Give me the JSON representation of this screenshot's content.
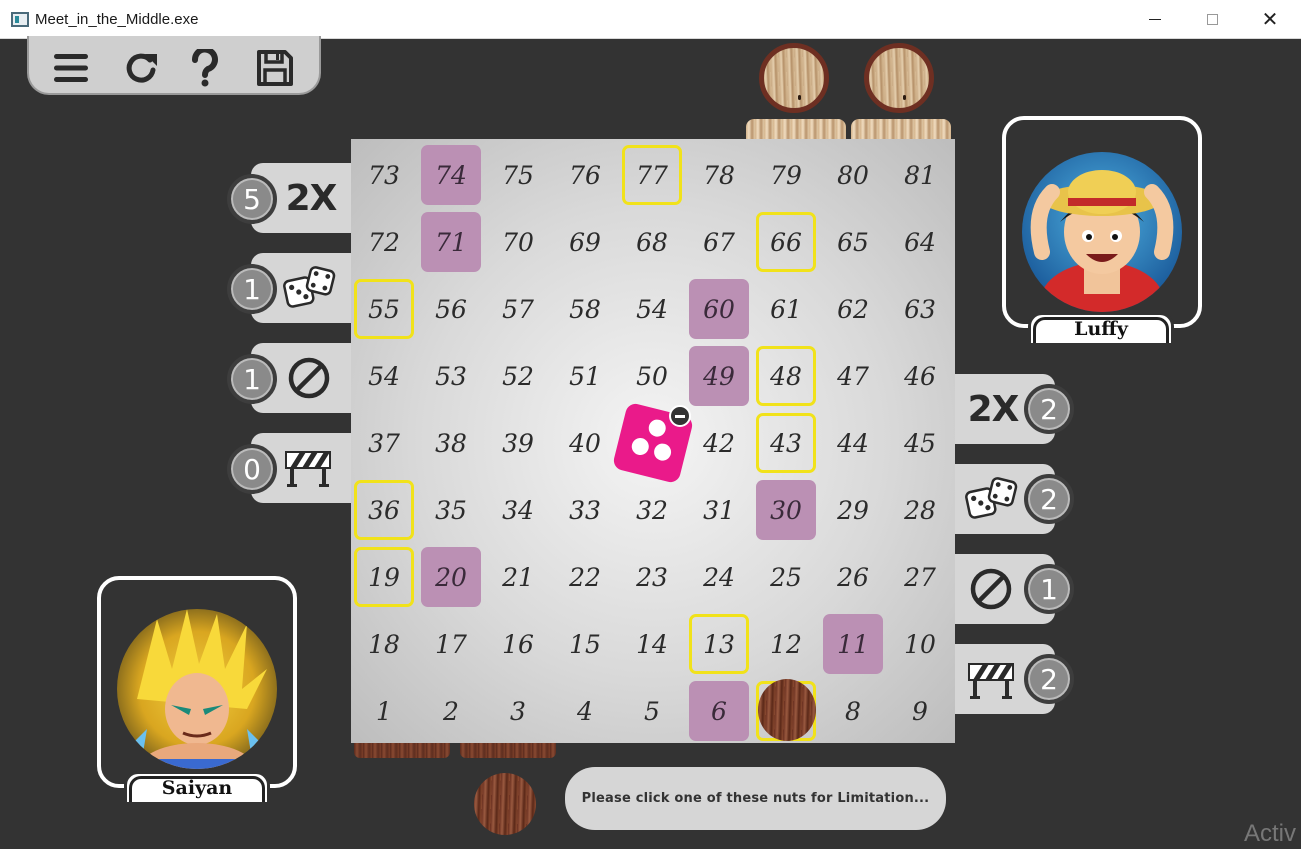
{
  "window": {
    "title": "Meet_in_the_Middle.exe"
  },
  "toolbar": {
    "icons": [
      "menu-icon",
      "restart-icon",
      "help-icon",
      "save-icon"
    ]
  },
  "board": {
    "rows": [
      [
        "73",
        "74",
        "75",
        "76",
        "77",
        "78",
        "79",
        "80",
        "81"
      ],
      [
        "72",
        "71",
        "70",
        "69",
        "68",
        "67",
        "66",
        "65",
        "64"
      ],
      [
        "55",
        "56",
        "57",
        "58",
        "54",
        "60",
        "61",
        "62",
        "63"
      ],
      [
        "54",
        "53",
        "52",
        "51",
        "50",
        "49",
        "48",
        "47",
        "46"
      ],
      [
        "37",
        "38",
        "39",
        "40",
        "",
        "42",
        "43",
        "44",
        "45"
      ],
      [
        "36",
        "35",
        "34",
        "33",
        "32",
        "31",
        "30",
        "29",
        "28"
      ],
      [
        "19",
        "20",
        "21",
        "22",
        "23",
        "24",
        "25",
        "26",
        "27"
      ],
      [
        "18",
        "17",
        "16",
        "15",
        "14",
        "13",
        "12",
        "11",
        "10"
      ],
      [
        "1",
        "2",
        "3",
        "4",
        "5",
        "6",
        "",
        "8",
        "9"
      ]
    ],
    "purple_cells": [
      "74",
      "71",
      "60",
      "49",
      "30",
      "20",
      "11",
      "6"
    ],
    "yellow_cells": [
      "77",
      "66",
      "55",
      "48",
      "43",
      "36",
      "19",
      "13",
      "7"
    ],
    "colors": {
      "purple": "#bb90b4",
      "yellow_border": "#f1e21a",
      "die": "#ea1a8a"
    }
  },
  "players": {
    "top": {
      "name": "Luffy"
    },
    "bottom": {
      "name": "Saiyan"
    }
  },
  "powerups_left": [
    {
      "icon": "double-icon",
      "label": "2X",
      "count": "5"
    },
    {
      "icon": "dice-icon",
      "label": "",
      "count": "1"
    },
    {
      "icon": "block-icon",
      "label": "",
      "count": "1"
    },
    {
      "icon": "barrier-icon",
      "label": "",
      "count": "0"
    }
  ],
  "powerups_right": [
    {
      "icon": "double-icon",
      "label": "2X",
      "count": "2"
    },
    {
      "icon": "dice-icon",
      "label": "",
      "count": "2"
    },
    {
      "icon": "block-icon",
      "label": "",
      "count": "1"
    },
    {
      "icon": "barrier-icon",
      "label": "",
      "count": "2"
    }
  ],
  "message": "Please click one of these nuts for Limitation...",
  "watermark": "Activ"
}
